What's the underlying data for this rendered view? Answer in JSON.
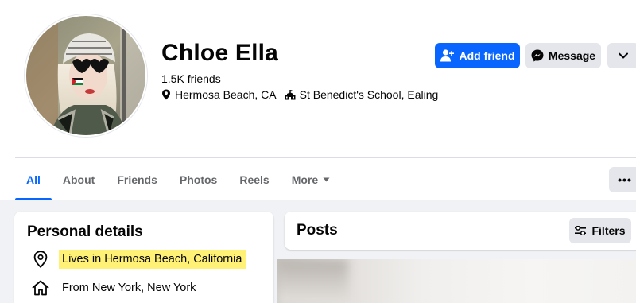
{
  "profile": {
    "name": "Chloe Ella",
    "friends": "1.5K friends",
    "location": "Hermosa Beach, CA",
    "school": "St Benedict's School, Ealing"
  },
  "actions": {
    "add_friend": "Add friend",
    "message": "Message"
  },
  "tabs": [
    {
      "label": "All",
      "active": true
    },
    {
      "label": "About",
      "active": false
    },
    {
      "label": "Friends",
      "active": false
    },
    {
      "label": "Photos",
      "active": false
    },
    {
      "label": "Reels",
      "active": false
    },
    {
      "label": "More",
      "active": false
    }
  ],
  "tab_overflow": "•••",
  "personal_details": {
    "title": "Personal details",
    "items": [
      {
        "icon": "location-pin-icon",
        "text": "Lives in Hermosa Beach, California",
        "highlighted": true
      },
      {
        "icon": "home-icon",
        "text": "From New York, New York",
        "highlighted": false
      }
    ]
  },
  "posts": {
    "title": "Posts",
    "filters_label": "Filters"
  },
  "colors": {
    "primary": "#0866ff",
    "secondary_button": "#e4e6eb",
    "page_background": "#f0f2f5",
    "highlight": "#fff176",
    "muted_text": "#65676b"
  }
}
